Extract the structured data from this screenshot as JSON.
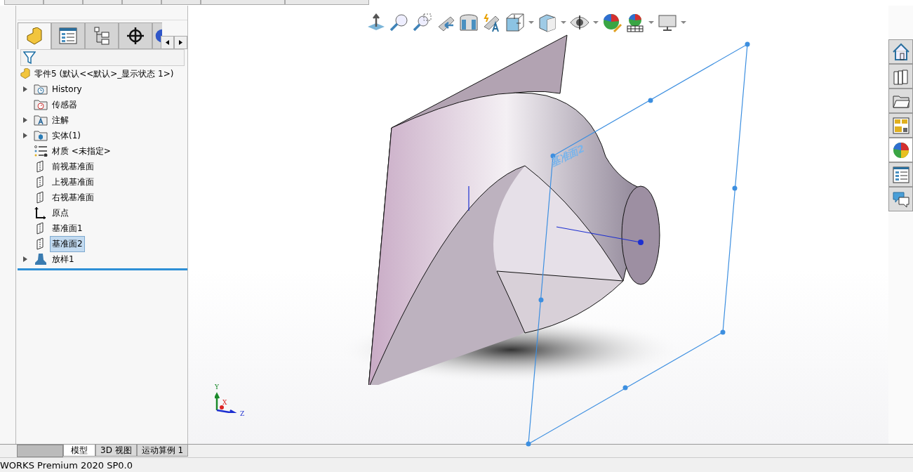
{
  "panel_tabs": [
    {
      "kind": "part",
      "selected": true
    },
    {
      "kind": "property",
      "selected": false
    },
    {
      "kind": "config",
      "selected": false
    },
    {
      "kind": "dimxpert",
      "selected": false
    },
    {
      "kind": "display",
      "selected": false
    }
  ],
  "tree": {
    "root": "零件5  (默认<<默认>_显示状态 1>)",
    "items": [
      {
        "label": "History",
        "kind": "history",
        "expanded": false,
        "selected": false
      },
      {
        "label": "传感器",
        "kind": "sensor",
        "selected": false
      },
      {
        "label": "注解",
        "kind": "annotation",
        "expanded": false,
        "selected": false
      },
      {
        "label": "实体(1)",
        "kind": "solid",
        "expanded": false,
        "selected": false
      },
      {
        "label": "材质 <未指定>",
        "kind": "material",
        "selected": false
      },
      {
        "label": "前视基准面",
        "kind": "plane",
        "selected": false
      },
      {
        "label": "上视基准面",
        "kind": "plane",
        "selected": false
      },
      {
        "label": "右视基准面",
        "kind": "plane",
        "selected": false
      },
      {
        "label": "原点",
        "kind": "origin",
        "selected": false
      },
      {
        "label": "基准面1",
        "kind": "plane",
        "selected": false
      },
      {
        "label": "基准面2",
        "kind": "plane",
        "selected": true
      },
      {
        "label": "放样1",
        "kind": "loft",
        "expanded": false,
        "selected": false
      }
    ]
  },
  "task_pane": [
    {
      "selected": false
    },
    {
      "selected": false
    },
    {
      "selected": false
    },
    {
      "selected": false
    },
    {
      "selected": true
    },
    {
      "selected": false
    },
    {
      "selected": false
    }
  ],
  "viewport": {
    "plane_label": "基准面2",
    "triad": {
      "y": "Y",
      "x": "X",
      "z": "Z"
    }
  },
  "bottom_tabs": [
    {
      "label": "模型",
      "selected": true
    },
    {
      "label": "3D 视图",
      "selected": false
    },
    {
      "label": "运动算例 1",
      "selected": false
    }
  ],
  "status_bar": "WORKS Premium 2020 SP0.0"
}
